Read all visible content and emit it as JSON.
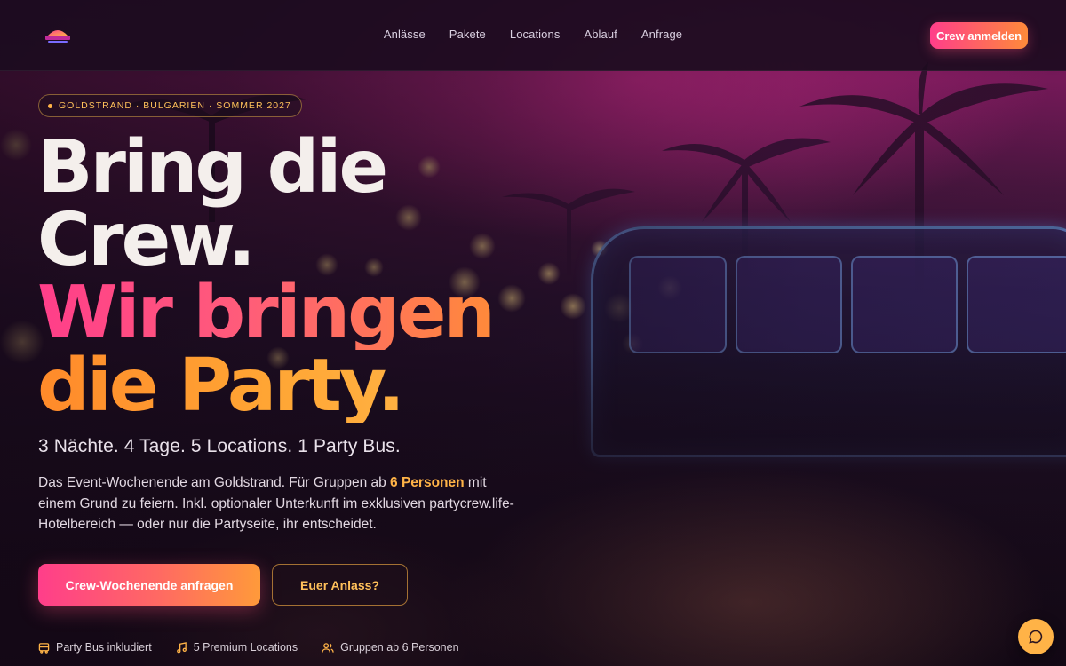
{
  "brand": {
    "logo_alt": "PARTYCREW"
  },
  "nav": {
    "items": [
      {
        "label": "Anlässe"
      },
      {
        "label": "Pakete"
      },
      {
        "label": "Locations"
      },
      {
        "label": "Ablauf"
      },
      {
        "label": "Anfrage"
      }
    ],
    "cta_label": "Crew anmelden"
  },
  "hero": {
    "badge": "GOLDSTRAND · BULGARIEN · SOMMER 2027",
    "headline_line1": "Bring die",
    "headline_line2": "Crew.",
    "headline_line3": "Wir bringen",
    "headline_line4": "die Party.",
    "subline": "3 Nächte. 4 Tage. 5 Locations. 1 Party Bus.",
    "desc_part1": "Das Event-Wochenende am Goldstrand. Für Gruppen ab ",
    "desc_highlight": "6 Personen",
    "desc_part2": " mit einem Grund zu feiern. Inkl. optionaler Unterkunft im exklusiven partycrew.life-Hotelbereich — oder nur die Partyseite, ihr entscheidet.",
    "primary_button": "Crew-Wochenende anfragen",
    "secondary_button": "Euer Anlass?"
  },
  "features": [
    {
      "icon": "bus-icon",
      "label": "Party Bus inkludiert"
    },
    {
      "icon": "music-note-icon",
      "label": "5 Premium Locations"
    },
    {
      "icon": "users-icon",
      "label": "Gruppen ab 6 Personen"
    }
  ],
  "colors": {
    "accent_pink": "#ff3e8a",
    "accent_orange": "#ff8a3a",
    "accent_gold": "#ffb347",
    "header_bg": "#1c0c20"
  }
}
